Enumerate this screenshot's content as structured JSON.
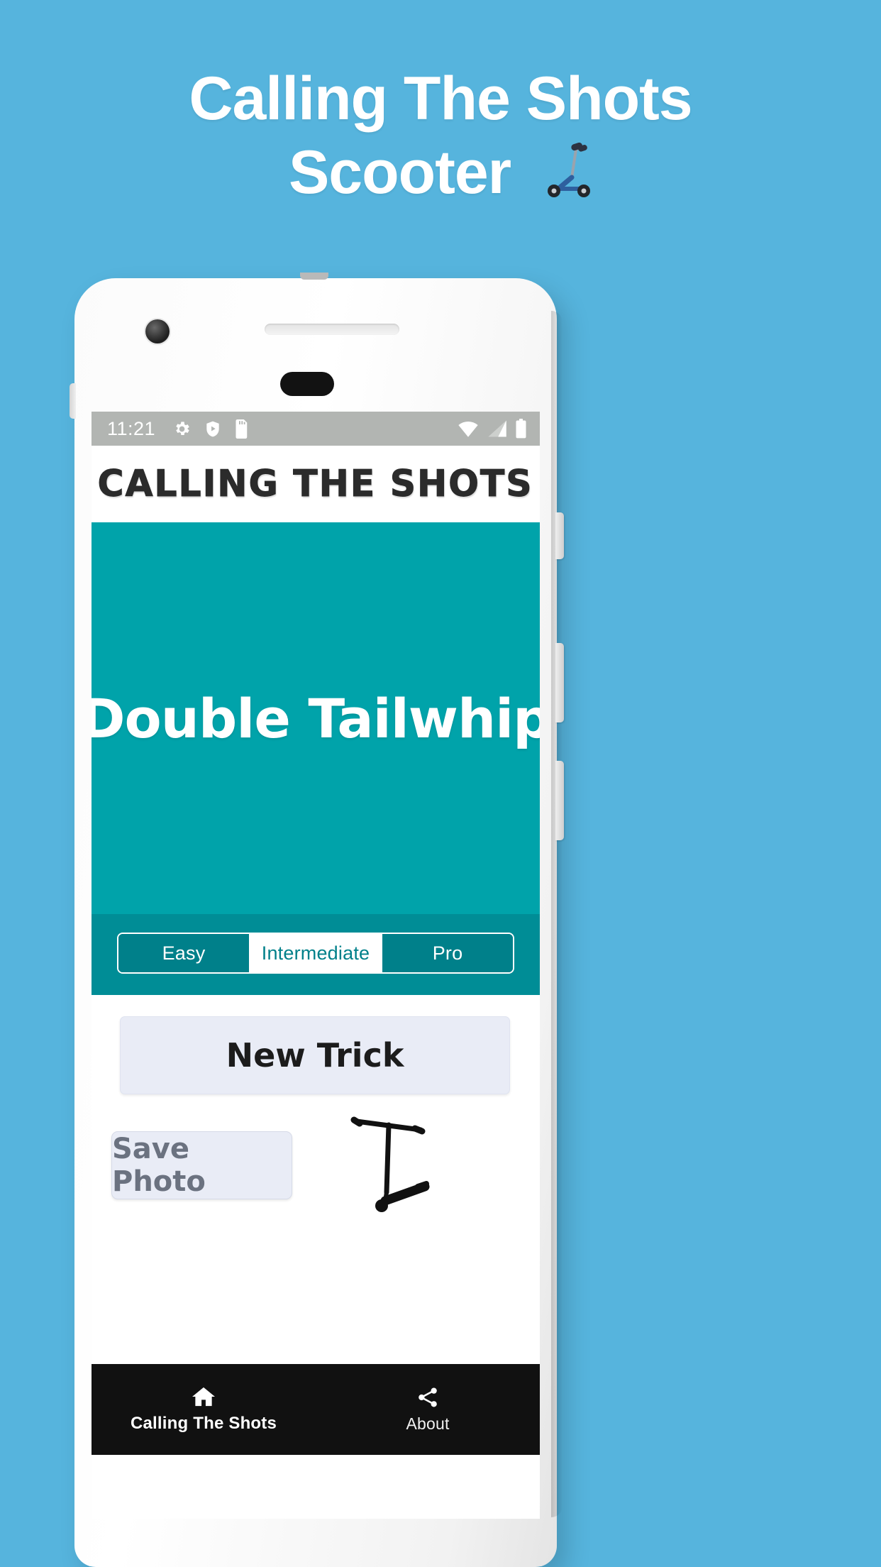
{
  "promo": {
    "line1": "Calling The Shots",
    "line2": "Scooter",
    "emoji_name": "kick-scooter-emoji",
    "background_color": "#56b4dd",
    "text_color": "#ffffff"
  },
  "phone": {
    "statusbar": {
      "time": "11:21",
      "left_icons": [
        "gear-icon",
        "play-shield-icon",
        "sd-card-icon"
      ],
      "right_icons": [
        "wifi-icon",
        "cell-signal-icon",
        "battery-icon"
      ],
      "background_color": "#b2b5b2"
    },
    "app": {
      "title": "CALLING THE SHOTS",
      "hero": {
        "trick_name": "Double Tailwhip",
        "background_color": "#00A3AA"
      },
      "difficulty": {
        "options": [
          {
            "label": "Easy",
            "selected": false
          },
          {
            "label": "Intermediate",
            "selected": true
          },
          {
            "label": "Pro",
            "selected": false
          }
        ],
        "selected_value": "Intermediate"
      },
      "buttons": {
        "new_trick": "New Trick",
        "save_photo": "Save Photo"
      },
      "illustration": "scooter-line-art",
      "bottom_nav": [
        {
          "label": "Calling The Shots",
          "icon": "home-icon"
        },
        {
          "label": "About",
          "icon": "share-icon"
        }
      ]
    }
  }
}
